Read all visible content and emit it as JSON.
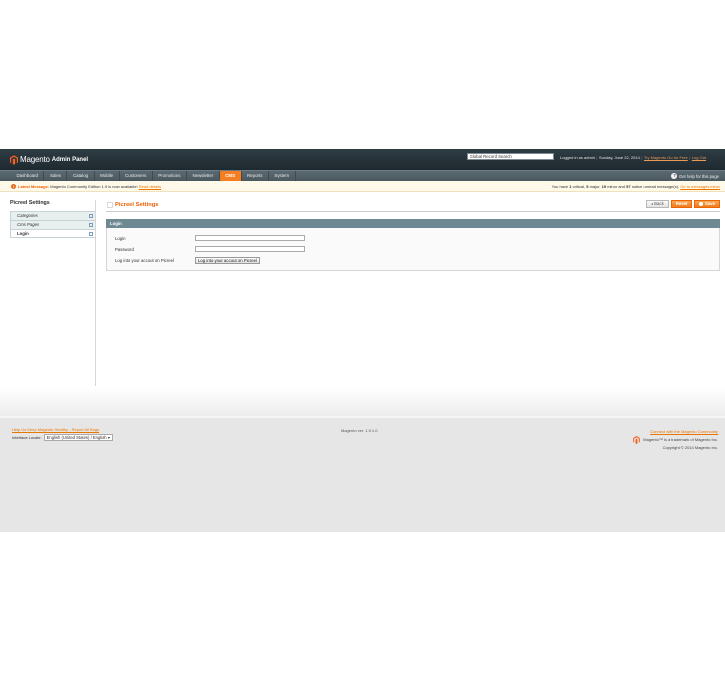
{
  "header": {
    "logo_text": "Magento",
    "logo_sub": "Admin Panel",
    "search_value": "Global Record Search",
    "logged_in": "Logged in as admin",
    "date": "Sunday, June 22, 2014",
    "try_link": "Try Magento Go for Free",
    "logout": "Log Out"
  },
  "nav": {
    "items": [
      "Dashboard",
      "Sales",
      "Catalog",
      "Mobile",
      "Customers",
      "Promotions",
      "Newsletter",
      "CMS",
      "Reports",
      "System"
    ],
    "active": "CMS",
    "help": "Get help for this page"
  },
  "message": {
    "label": "Latest Message:",
    "text": "Magento Community Edition 1.9 is now available!",
    "link": "Read details",
    "right_prefix": "You have",
    "critical_count": "1",
    "critical_label": "critical,",
    "major_count": "5",
    "major_label": "major,",
    "minor_count": "19",
    "minor_label": "minor and",
    "notice_count": "57",
    "notice_label": "notice unread message(s).",
    "right_link": "Go to messages inbox"
  },
  "sidebar": {
    "title": "Picreel Settings",
    "tabs": [
      "Categories",
      "Cms Pages",
      "Login"
    ]
  },
  "main": {
    "title": "Picreel Settings",
    "back_label": "Back",
    "reset_label": "Reset",
    "save_label": "Save",
    "fieldset_title": "Login",
    "login_label": "Login",
    "password_label": "Password",
    "login_to_label": "Log into your accout on Picreel",
    "login_to_button": "Log into your accout on Picreel"
  },
  "footer": {
    "help_link": "Help Us Keep Magento Healthy - Report All Bugs",
    "locale_label": "Interface Locale:",
    "locale_value": "English (United States) / English",
    "version": "Magento ver. 1.9.1.0",
    "community_link": "Connect with the Magento Community",
    "trademark": "Magento™ is a trademark of Magento Inc.",
    "copyright": "Copyright © 2014 Magento Inc."
  },
  "colors": {
    "accent": "#eb5e00",
    "header_bg": "#2e3c44",
    "nav_bg": "#4a585f",
    "fieldset_head": "#6f8992"
  }
}
